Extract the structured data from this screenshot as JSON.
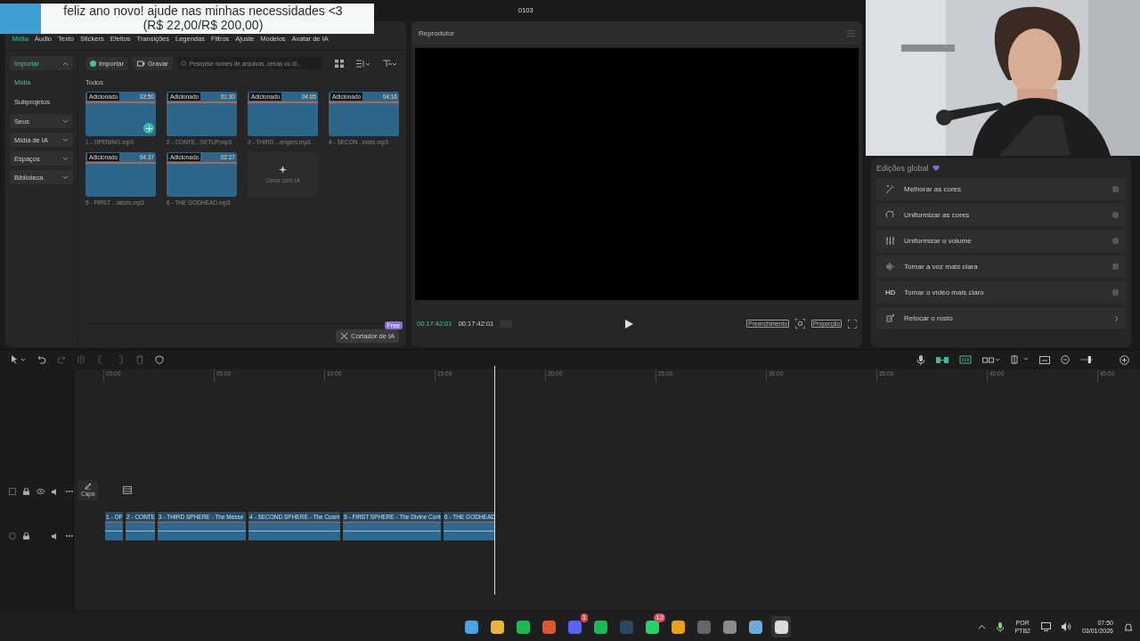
{
  "banner": {
    "lines": [
      "feliz ano novo! ajude nas minhas necessidades <3",
      "(R$ 22,00/R$ 200,00)"
    ]
  },
  "window": {
    "title": "0103"
  },
  "media_tabs": [
    {
      "label": "Mídia",
      "selected": true
    },
    {
      "label": "Áudio",
      "selected": false
    },
    {
      "label": "Texto",
      "selected": false
    },
    {
      "label": "Stickers",
      "selected": false
    },
    {
      "label": "Efeitos",
      "selected": false
    },
    {
      "label": "Transições",
      "selected": false
    },
    {
      "label": "Legendas",
      "selected": false
    },
    {
      "label": "Filtros",
      "selected": false
    },
    {
      "label": "Ajuste",
      "selected": false
    },
    {
      "label": "Modelos",
      "selected": false
    },
    {
      "label": "Avatar de IA",
      "selected": false
    }
  ],
  "sidebar": [
    {
      "label": "Importar",
      "kind": "section",
      "expanded": true,
      "selected": true
    },
    {
      "label": "Mídia",
      "kind": "link",
      "selected": true
    },
    {
      "label": "Subprojetos",
      "kind": "link",
      "selected": false
    },
    {
      "label": "Seus",
      "kind": "section",
      "expanded": false,
      "selected": false
    },
    {
      "label": "Mídia de IA",
      "kind": "section",
      "expanded": false,
      "selected": false
    },
    {
      "label": "Espaços",
      "kind": "section",
      "expanded": false,
      "selected": false
    },
    {
      "label": "Biblioteca",
      "kind": "section",
      "expanded": false,
      "selected": false
    }
  ],
  "toolbar": {
    "import": "Importar",
    "record": "Gravar",
    "search_placeholder": "Pesquise nomes de arquivos, cenas ou di..."
  },
  "section_label": "Todos",
  "media": [
    {
      "badge": "Adicionado",
      "duration": "03:50",
      "name": "1 - OPENING.mp3"
    },
    {
      "badge": "Adicionado",
      "duration": "01:30",
      "name": "2 - CONTE...SETUP.mp3"
    },
    {
      "badge": "Adicionado",
      "duration": "04:05",
      "name": "3 - THIRD ...engers.mp3"
    },
    {
      "badge": "Adicionado",
      "duration": "04:16",
      "name": "4 - SECON...mors.mp3"
    },
    {
      "badge": "Adicionado",
      "duration": "04:37",
      "name": "5 - FIRST ...lators.mp3"
    },
    {
      "badge": "Adicionado",
      "duration": "02:27",
      "name": "6 - THE GODHEAD.mp3"
    }
  ],
  "generate_tile": "Gerar com IA",
  "cutter": {
    "label": "Cortador de IA",
    "badge": "Free"
  },
  "player": {
    "title": "Reprodutor",
    "current": "00:17:42:01",
    "total": "00:17:42:01",
    "fill": "Preenchimento",
    "ratio": "Proporção"
  },
  "global_edits": {
    "title": "Edições global",
    "items": [
      {
        "label": "Melhorar as cores",
        "kind": "toggle",
        "on": false
      },
      {
        "label": "Uniformizar as cores",
        "kind": "toggle",
        "on": false
      },
      {
        "label": "Uniformizar o volume",
        "kind": "toggle",
        "on": false
      },
      {
        "label": "Tornar a voz mais clara",
        "kind": "toggle",
        "on": false
      },
      {
        "label": "Tornar o vídeo mais claro",
        "kind": "toggle",
        "on": false,
        "icon_text": "HD"
      },
      {
        "label": "Retocar o rosto",
        "kind": "link"
      }
    ]
  },
  "timeline": {
    "ticks": [
      "00:00",
      "05:00",
      "10:00",
      "15:00",
      "20:00",
      "25:00",
      "30:00",
      "35:00",
      "40:00",
      "45:00"
    ],
    "cover": "Capa",
    "clips": [
      "1 - OF",
      "2 - CONTE",
      "3 - THIRD SPHERE - The Messe",
      "4 - SECOND SPHERE - The Cosm",
      "5 - FIRST SPHERE - The Divine Cont",
      "6 - THE GODHEAD"
    ]
  },
  "zoom": {
    "level": 0.8
  },
  "taskbar": {
    "badges": [
      "1",
      "12"
    ],
    "language": "POR",
    "layout": "PTB2",
    "time": "07:50",
    "date": "03/01/2026"
  }
}
